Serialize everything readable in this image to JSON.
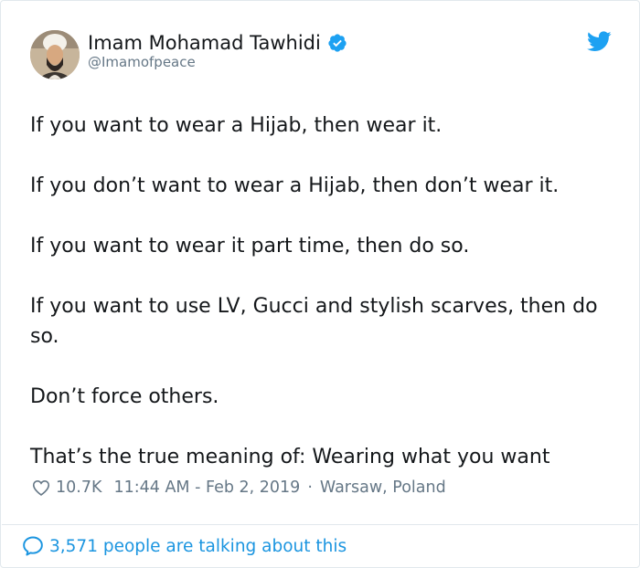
{
  "author": {
    "display_name": "Imam Mohamad Tawhidi",
    "handle": "@Imamofpeace",
    "verified": true
  },
  "tweet": {
    "paragraphs": [
      "If you want to wear a Hijab, then wear it.",
      "If you don’t want to wear a Hijab, then don’t wear it.",
      "If you want to wear it part time, then do so.",
      "If you want to use LV, Gucci and stylish scarves, then do so.",
      "Don’t force others.",
      "That’s the true meaning of: Wearing what you want"
    ]
  },
  "meta": {
    "likes": "10.7K",
    "timestamp": "11:44 AM - Feb 2, 2019",
    "separator": "·",
    "location": "Warsaw, Poland"
  },
  "footer": {
    "talking_text": "3,571 people are talking about this"
  },
  "icons": {
    "verified": "verified-badge-icon",
    "brand": "twitter-bird-icon",
    "like": "heart-icon",
    "reply": "speech-bubble-icon"
  },
  "colors": {
    "text": "#14171a",
    "secondary": "#657786",
    "accent": "#1da1f2",
    "link": "#1b95e0",
    "border": "#e1e8ed"
  }
}
